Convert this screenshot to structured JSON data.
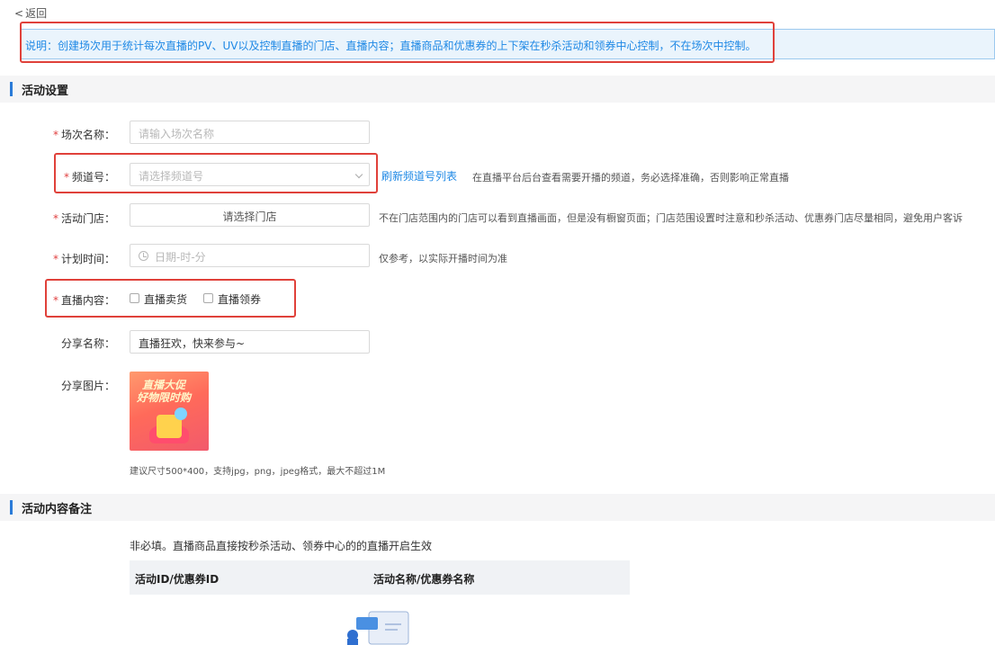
{
  "nav": {
    "back_label": "返回"
  },
  "notice": {
    "text": "说明：创建场次用于统计每次直播的PV、UV以及控制直播的门店、直播内容；直播商品和优惠券的上下架在秒杀活动和领券中心控制，不在场次中控制。"
  },
  "section_settings": {
    "title": "活动设置"
  },
  "form": {
    "session_name": {
      "label": "场次名称：",
      "placeholder": "请输入场次名称",
      "required": true
    },
    "channel": {
      "label": "频道号：",
      "placeholder": "请选择频道号",
      "refresh_link": "刷新频道号列表",
      "hint": "在直播平台后台查看需要开播的频道，务必选择准确，否则影响正常直播",
      "required": true
    },
    "store": {
      "label": "活动门店：",
      "button_label": "请选择门店",
      "hint": "不在门店范围内的门店可以看到直播画面，但是没有橱窗页面；门店范围设置时注意和秒杀活动、优惠券门店尽量相同，避免用户客诉",
      "required": true
    },
    "plan_time": {
      "label": "计划时间：",
      "placeholder": "日期-时-分",
      "hint": "仅参考，以实际开播时间为准",
      "required": true
    },
    "live_content": {
      "label": "直播内容：",
      "options": [
        "直播卖货",
        "直播领券"
      ],
      "required": true
    },
    "share_name": {
      "label": "分享名称：",
      "value": "直播狂欢，快来参与~"
    },
    "share_image": {
      "label": "分享图片：",
      "image_text_1": "直播大促",
      "image_text_2": "好物限时购",
      "hint": "建议尺寸500*400，支持jpg，png，jpeg格式，最大不超过1M"
    }
  },
  "section_remark": {
    "title": "活动内容备注",
    "description": "非必填。直播商品直接按秒杀活动、领券中心的的直播开启生效",
    "columns": [
      "活动ID/优惠券ID",
      "活动名称/优惠券名称"
    ]
  },
  "colors": {
    "accent": "#1e88e5",
    "highlight": "#e0413a",
    "required": "#e04040",
    "notice_bg": "#eaf4fc"
  },
  "icons": {
    "back": "chevron-left-icon",
    "select": "chevron-down-icon",
    "time": "clock-icon"
  }
}
